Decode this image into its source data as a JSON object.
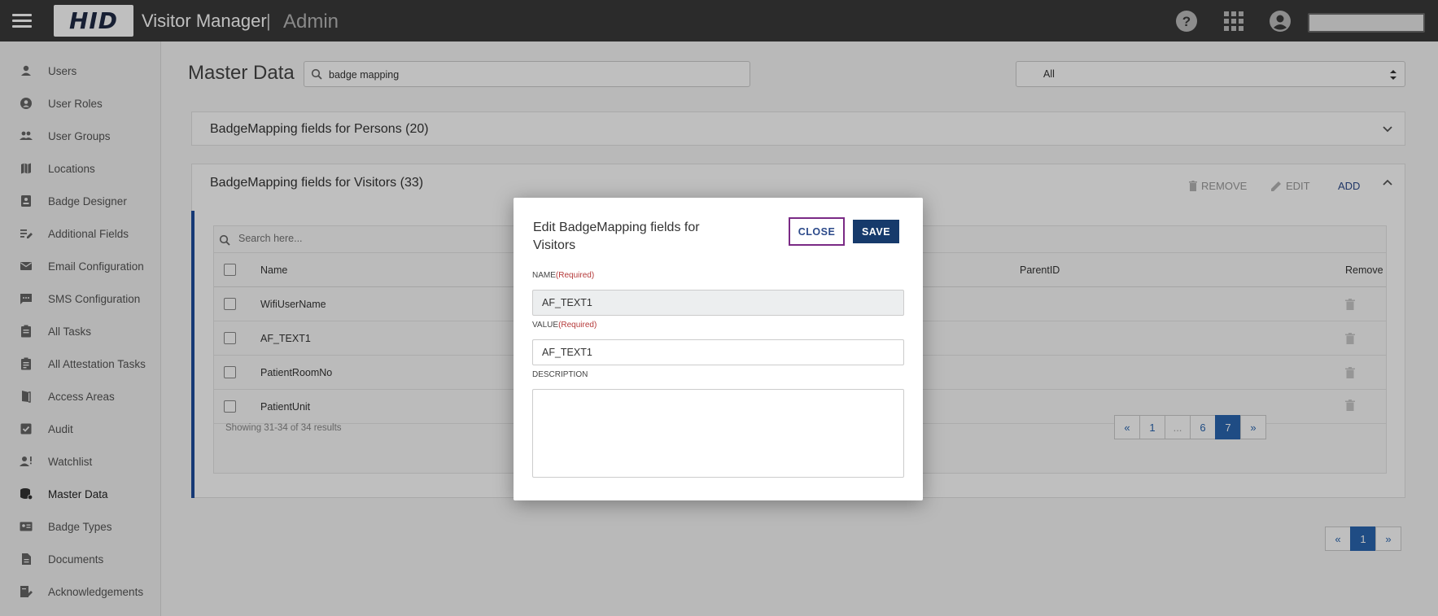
{
  "header": {
    "logo": "HID",
    "app_title": "Visitor Manager",
    "separator": "|",
    "section": "Admin"
  },
  "sidebar": {
    "items": [
      {
        "label": "Users",
        "icon": "person-icon"
      },
      {
        "label": "User Roles",
        "icon": "account-circle-icon"
      },
      {
        "label": "User Groups",
        "icon": "group-icon"
      },
      {
        "label": "Locations",
        "icon": "map-icon"
      },
      {
        "label": "Badge Designer",
        "icon": "badge-icon"
      },
      {
        "label": "Additional Fields",
        "icon": "edit-note-icon"
      },
      {
        "label": "Email Configuration",
        "icon": "mail-icon"
      },
      {
        "label": "SMS Configuration",
        "icon": "sms-icon"
      },
      {
        "label": "All Tasks",
        "icon": "clipboard-icon"
      },
      {
        "label": "All Attestation Tasks",
        "icon": "clipboard-check-icon"
      },
      {
        "label": "Access Areas",
        "icon": "door-icon"
      },
      {
        "label": "Audit",
        "icon": "checkbox-icon"
      },
      {
        "label": "Watchlist",
        "icon": "person-alert-icon"
      },
      {
        "label": "Master Data",
        "icon": "database-icon"
      },
      {
        "label": "Badge Types",
        "icon": "id-card-icon"
      },
      {
        "label": "Documents",
        "icon": "document-icon"
      },
      {
        "label": "Acknowledgements",
        "icon": "sign-icon"
      }
    ],
    "active": "Master Data"
  },
  "main": {
    "title": "Master Data",
    "search_value": "badge mapping",
    "filter_value": "All",
    "panel_persons": {
      "title": "BadgeMapping fields for Persons (20)"
    },
    "panel_visitors": {
      "title": "BadgeMapping fields for Visitors (33)",
      "remove_label": "REMOVE",
      "edit_label": "EDIT",
      "add_label": "ADD",
      "search_placeholder": "Search here...",
      "columns": {
        "name": "Name",
        "parent": "ParentID",
        "remove": "Remove"
      },
      "rows": [
        {
          "name": "WifiUserName"
        },
        {
          "name": "AF_TEXT1"
        },
        {
          "name": "PatientRoomNo"
        },
        {
          "name": "PatientUnit"
        }
      ],
      "showing": "Showing 31-34 of 34 results",
      "pages": [
        "«",
        "1",
        "...",
        "6",
        "7",
        "»"
      ],
      "active_page": "7"
    },
    "outer_pages": [
      "«",
      "1",
      "»"
    ],
    "outer_active_page": "1"
  },
  "modal": {
    "title": "Edit BadgeMapping fields for Visitors",
    "close_label": "CLOSE",
    "save_label": "SAVE",
    "name_label": "NAME",
    "name_required": "(Required)",
    "name_value": "AF_TEXT1",
    "value_label": "VALUE",
    "value_required": "(Required)",
    "value_value": "AF_TEXT1",
    "description_label": "DESCRIPTION",
    "description_value": ""
  },
  "colors": {
    "topbar": "#3a3a3a",
    "accent_blue": "#2a66b0",
    "save_button": "#163a6b",
    "close_border": "#7a2a85",
    "required_text": "#b53a3a"
  }
}
